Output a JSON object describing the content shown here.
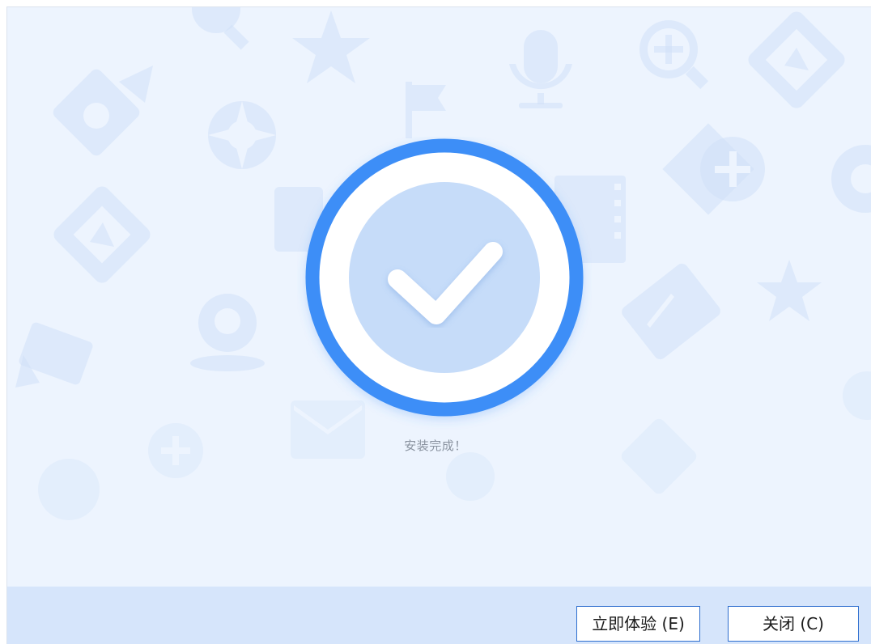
{
  "installer": {
    "status_text": "安装完成！",
    "buttons": {
      "try_now_label": "立即体验 (E)",
      "close_label": "关闭 (C)"
    }
  },
  "colors": {
    "background": "#edf4fe",
    "footer": "#d6e5fb",
    "ring": "#3d8ef7",
    "inner_circle": "#c6dcf9",
    "checkmark": "#ffffff",
    "button_border": "#2f6fcf"
  },
  "icons": {
    "success": "checkmark-circle-icon",
    "background": [
      "zoom-in-icon",
      "star-icon",
      "microphone-icon",
      "flag-icon",
      "video-camera-icon",
      "aperture-icon",
      "image-icon",
      "film-strip-icon",
      "location-pin-icon",
      "envelope-icon"
    ]
  }
}
